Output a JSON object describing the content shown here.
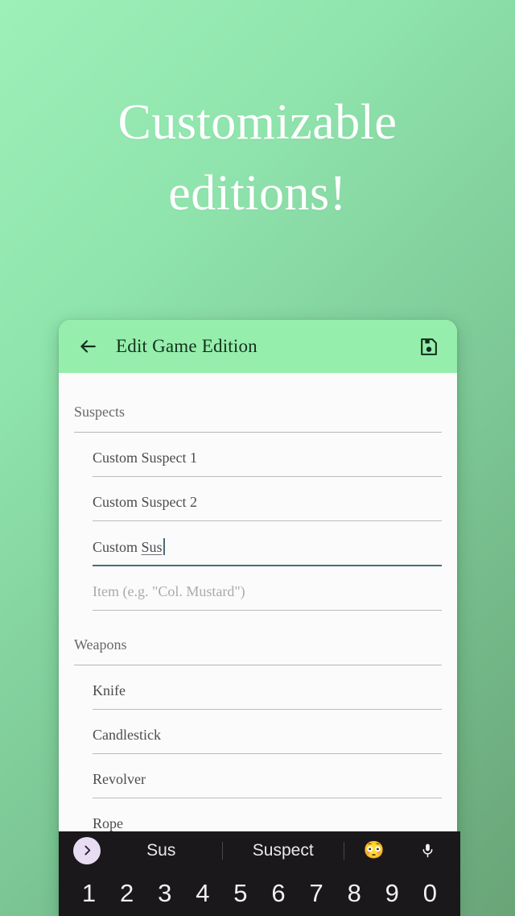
{
  "promo": {
    "line1": "Customizable",
    "line2": "editions!"
  },
  "appbar": {
    "back_icon": "arrow-left-icon",
    "title": "Edit Game Edition",
    "save_icon": "save-floppy-disk-icon",
    "background_color": "#96EEAC"
  },
  "form": {
    "sections": [
      {
        "header": "Suspects",
        "fields": [
          {
            "value": "Custom Suspect 1",
            "state": "filled"
          },
          {
            "value": "Custom Suspect 2",
            "state": "filled"
          },
          {
            "value": "Custom ",
            "composing": "Sus",
            "state": "focused"
          },
          {
            "placeholder": "Item (e.g. \"Col. Mustard\")",
            "state": "empty"
          }
        ]
      },
      {
        "header": "Weapons",
        "fields": [
          {
            "value": "Knife",
            "state": "filled"
          },
          {
            "value": "Candlestick",
            "state": "filled"
          },
          {
            "value": "Revolver",
            "state": "filled"
          },
          {
            "value": "Rope",
            "state": "filled"
          }
        ]
      }
    ]
  },
  "keyboard": {
    "expand_icon": "chevron-right-icon",
    "suggestions": [
      "Sus",
      "Suspect"
    ],
    "emoji": "😳",
    "mic_icon": "microphone-icon",
    "number_row": [
      "1",
      "2",
      "3",
      "4",
      "5",
      "6",
      "7",
      "8",
      "9",
      "0"
    ],
    "background_color": "#1A181B",
    "expand_button_color": "#E8DCF2"
  },
  "theme": {
    "gradient_start": "#9DF0B8",
    "gradient_end": "#69A477",
    "accent_underline": "#4D6C75",
    "card_background": "#FBFBFB"
  }
}
